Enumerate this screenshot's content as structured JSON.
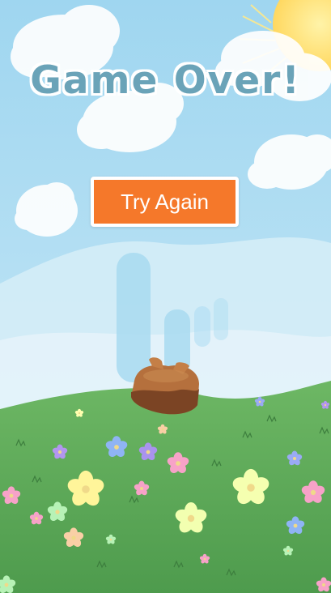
{
  "game": {
    "title": "Game Over!",
    "retry_label": "Try Again"
  },
  "colors": {
    "sky": "#bfe4f5",
    "grass": "#5fa95a",
    "button": "#f5782a",
    "title": "#6aa3b8",
    "sun": "#ffe27a",
    "stump": "#a9683a"
  },
  "icons": [
    "sun-icon",
    "cloud-icon",
    "flower-icon",
    "tree-stump-icon"
  ]
}
